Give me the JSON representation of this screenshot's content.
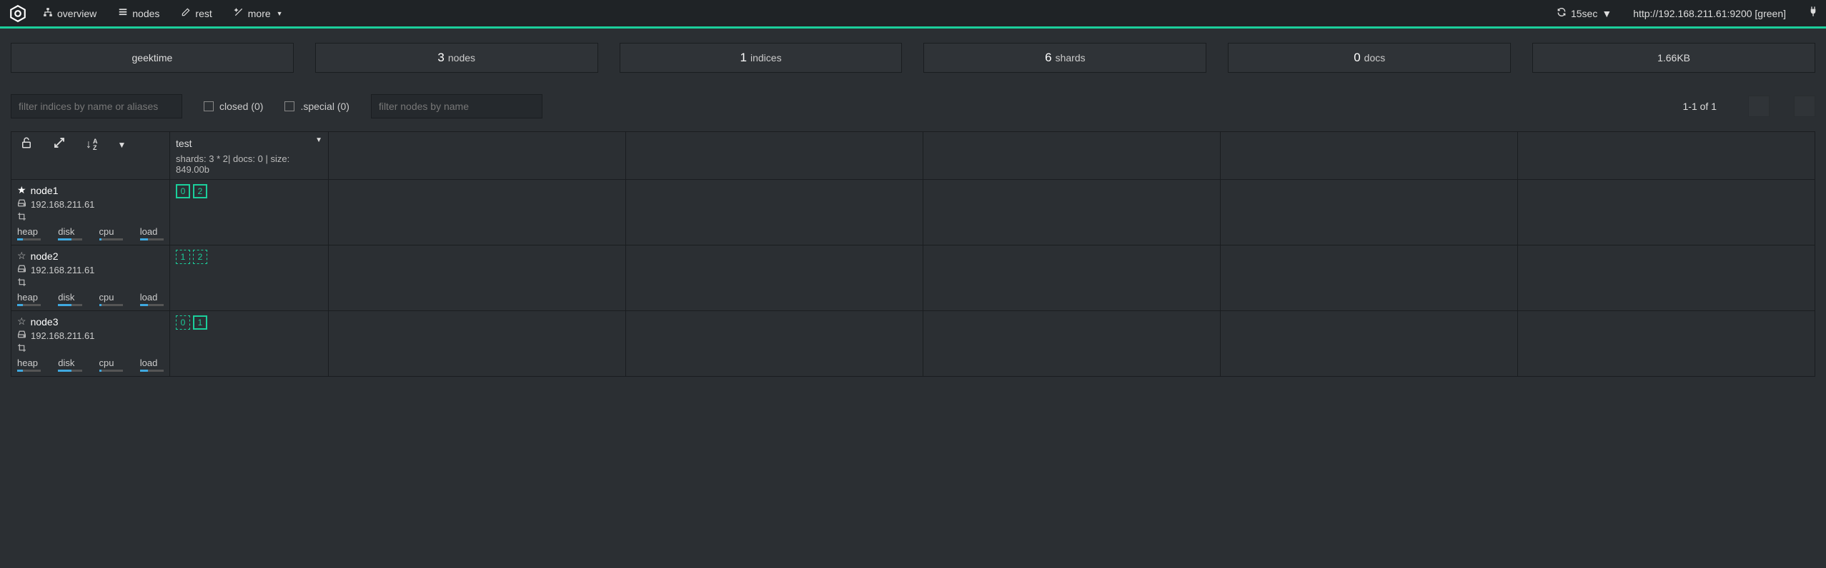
{
  "nav": {
    "overview": "overview",
    "nodes": "nodes",
    "rest": "rest",
    "more": "more"
  },
  "refresh": {
    "label": "15sec"
  },
  "host": "http://192.168.211.61:9200 [green]",
  "stats": {
    "cluster_name": "geektime",
    "nodes": {
      "num": "3",
      "label": "nodes"
    },
    "indices": {
      "num": "1",
      "label": "indices"
    },
    "shards": {
      "num": "6",
      "label": "shards"
    },
    "docs": {
      "num": "0",
      "label": "docs"
    },
    "size": "1.66KB"
  },
  "filters": {
    "indices_placeholder": "filter indices by name or aliases",
    "nodes_placeholder": "filter nodes by name",
    "closed_label": "closed (0)",
    "special_label": ".special (0)"
  },
  "pager": {
    "text": "1-1 of 1"
  },
  "index": {
    "name": "test",
    "detail": "shards: 3 * 2| docs: 0 | size: 849.00b"
  },
  "meter_labels": {
    "heap": "heap",
    "disk": "disk",
    "cpu": "cpu",
    "load": "load"
  },
  "nodes_list": [
    {
      "name": "node1",
      "host": "192.168.211.61",
      "star": "filled",
      "shards": [
        {
          "n": "0",
          "t": "primary"
        },
        {
          "n": "2",
          "t": "primary"
        }
      ]
    },
    {
      "name": "node2",
      "host": "192.168.211.61",
      "star": "outline",
      "shards": [
        {
          "n": "1",
          "t": "replica"
        },
        {
          "n": "2",
          "t": "replica"
        }
      ]
    },
    {
      "name": "node3",
      "host": "192.168.211.61",
      "star": "outline",
      "shards": [
        {
          "n": "0",
          "t": "replica"
        },
        {
          "n": "1",
          "t": "primary"
        }
      ]
    }
  ]
}
